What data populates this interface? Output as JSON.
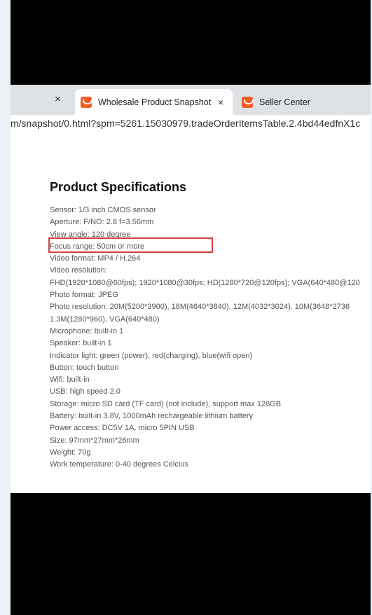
{
  "tabs": {
    "active_title": "Wholesale Product Snapshot P",
    "inactive_title": "Seller Center",
    "close_glyph": "×"
  },
  "address_bar": {
    "url": "m/snapshot/0.html?spm=5261.15030979.tradeOrderItemsTable.2.4bd44edfnX1c"
  },
  "page": {
    "title": "Product Specifications",
    "specs": [
      "Sensor: 1/3 inch CMOS sensor",
      "Aperture: F/NO: 2.8 f=3.56mm",
      "View angle: 120 degree",
      "Focus range: 50cm or more",
      "Video format: MP4 / H.264",
      "Video resolution:",
      "FHD(1920*1080@60fps); 1920*1080@30fps; HD(1280*720@120fps); VGA(640*480@120",
      "Photo format: JPEG",
      "Photo resolution: 20M(5200*3900), 18M(4640*3840), 12M(4032*3024), 10M(3648*2736",
      "1.3M(1280*960), VGA(640*480)",
      "Microphone: built-in 1",
      "Speaker: built-in 1",
      "Indicator light: green (power), red(charging), blue(wifi open)",
      "Button: touch button",
      "Wifi: built-in",
      "USB: high speed 2.0",
      "Storage: micro SD card (TF card) (not include), support max 128GB",
      "Battery: built-in 3.8V, 1000mAh rechargeable lithium battery",
      "Power access: DC5V 1A, micro 5PIN USB",
      "Size: 97mm*27mm*26mm",
      "Weight: 70g",
      "Work temperature: 0-40 degrees Celcius"
    ]
  },
  "colors": {
    "favicon": "#f25d22",
    "highlight": "#d43f3f"
  }
}
